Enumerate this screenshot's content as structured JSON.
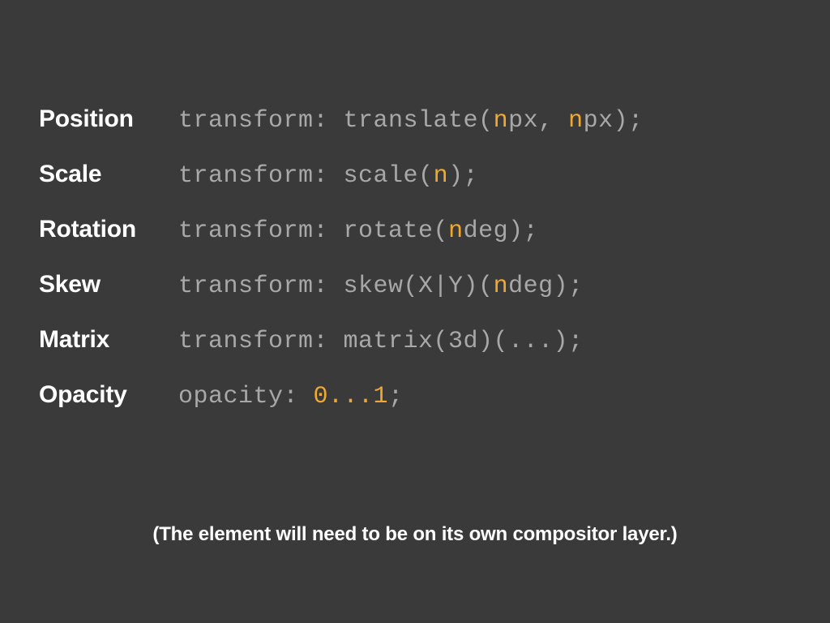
{
  "rows": [
    {
      "label": "Position",
      "segments": [
        {
          "text": "transform: translate("
        },
        {
          "text": "n",
          "hl": true
        },
        {
          "text": "px, "
        },
        {
          "text": "n",
          "hl": true
        },
        {
          "text": "px);"
        }
      ]
    },
    {
      "label": "Scale",
      "segments": [
        {
          "text": "transform: scale("
        },
        {
          "text": "n",
          "hl": true
        },
        {
          "text": ");"
        }
      ]
    },
    {
      "label": "Rotation",
      "segments": [
        {
          "text": "transform: rotate("
        },
        {
          "text": "n",
          "hl": true
        },
        {
          "text": "deg);"
        }
      ]
    },
    {
      "label": "Skew",
      "segments": [
        {
          "text": "transform: skew(X|Y)("
        },
        {
          "text": "n",
          "hl": true
        },
        {
          "text": "deg);"
        }
      ]
    },
    {
      "label": "Matrix",
      "segments": [
        {
          "text": "transform: matrix(3d)(...);"
        }
      ]
    },
    {
      "label": "Opacity",
      "segments": [
        {
          "text": "opacity: "
        },
        {
          "text": "0...1",
          "hl": true
        },
        {
          "text": ";"
        }
      ]
    }
  ],
  "footnote": "(The element will need to be on its own compositor layer.)"
}
